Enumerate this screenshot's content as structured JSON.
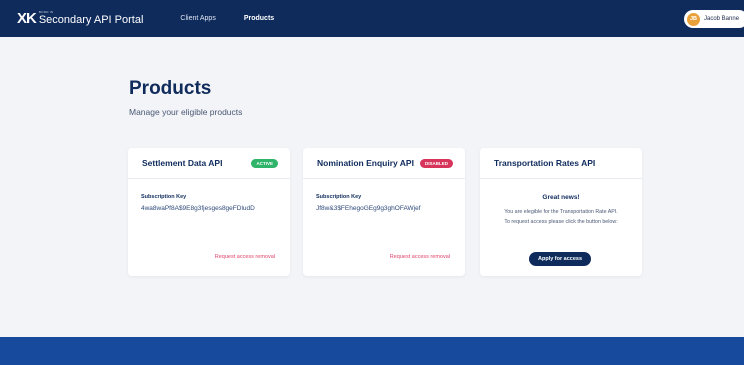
{
  "header": {
    "logo_mark": "XK",
    "logo_sub": "BOND IN",
    "app_title": "Secondary API Portal",
    "nav": [
      {
        "label": "Client Apps"
      },
      {
        "label": "Products"
      }
    ],
    "user": {
      "initials": "JB",
      "name": "Jacob Banne"
    }
  },
  "page": {
    "title": "Products",
    "subtitle": "Manage your eligible products"
  },
  "cards": [
    {
      "title": "Settlement Data API",
      "status": "ACTIVE",
      "key_label": "Subscription Key",
      "key_value": "4wa8waPf8A$9E8g3fjesges8geFDludD",
      "action": "Request access removal"
    },
    {
      "title": "Nomination Enquiry API",
      "status": "DISABLED",
      "key_label": "Subscription Key",
      "key_value": "Jf8w&3$FEhegoGEg9g3ghOFAWjef",
      "action": "Request access removal"
    },
    {
      "title": "Transportation Rates API",
      "promo_title": "Great news!",
      "promo_line1": "You are elegible for the Transportation Rate API.",
      "promo_line2": "To request access please click the button below:",
      "button": "Apply for access"
    }
  ],
  "colors": {
    "navy": "#0f2b5c",
    "footer": "#17499c",
    "active": "#2fb46a",
    "disabled": "#d6345a",
    "link": "#e0436b"
  }
}
